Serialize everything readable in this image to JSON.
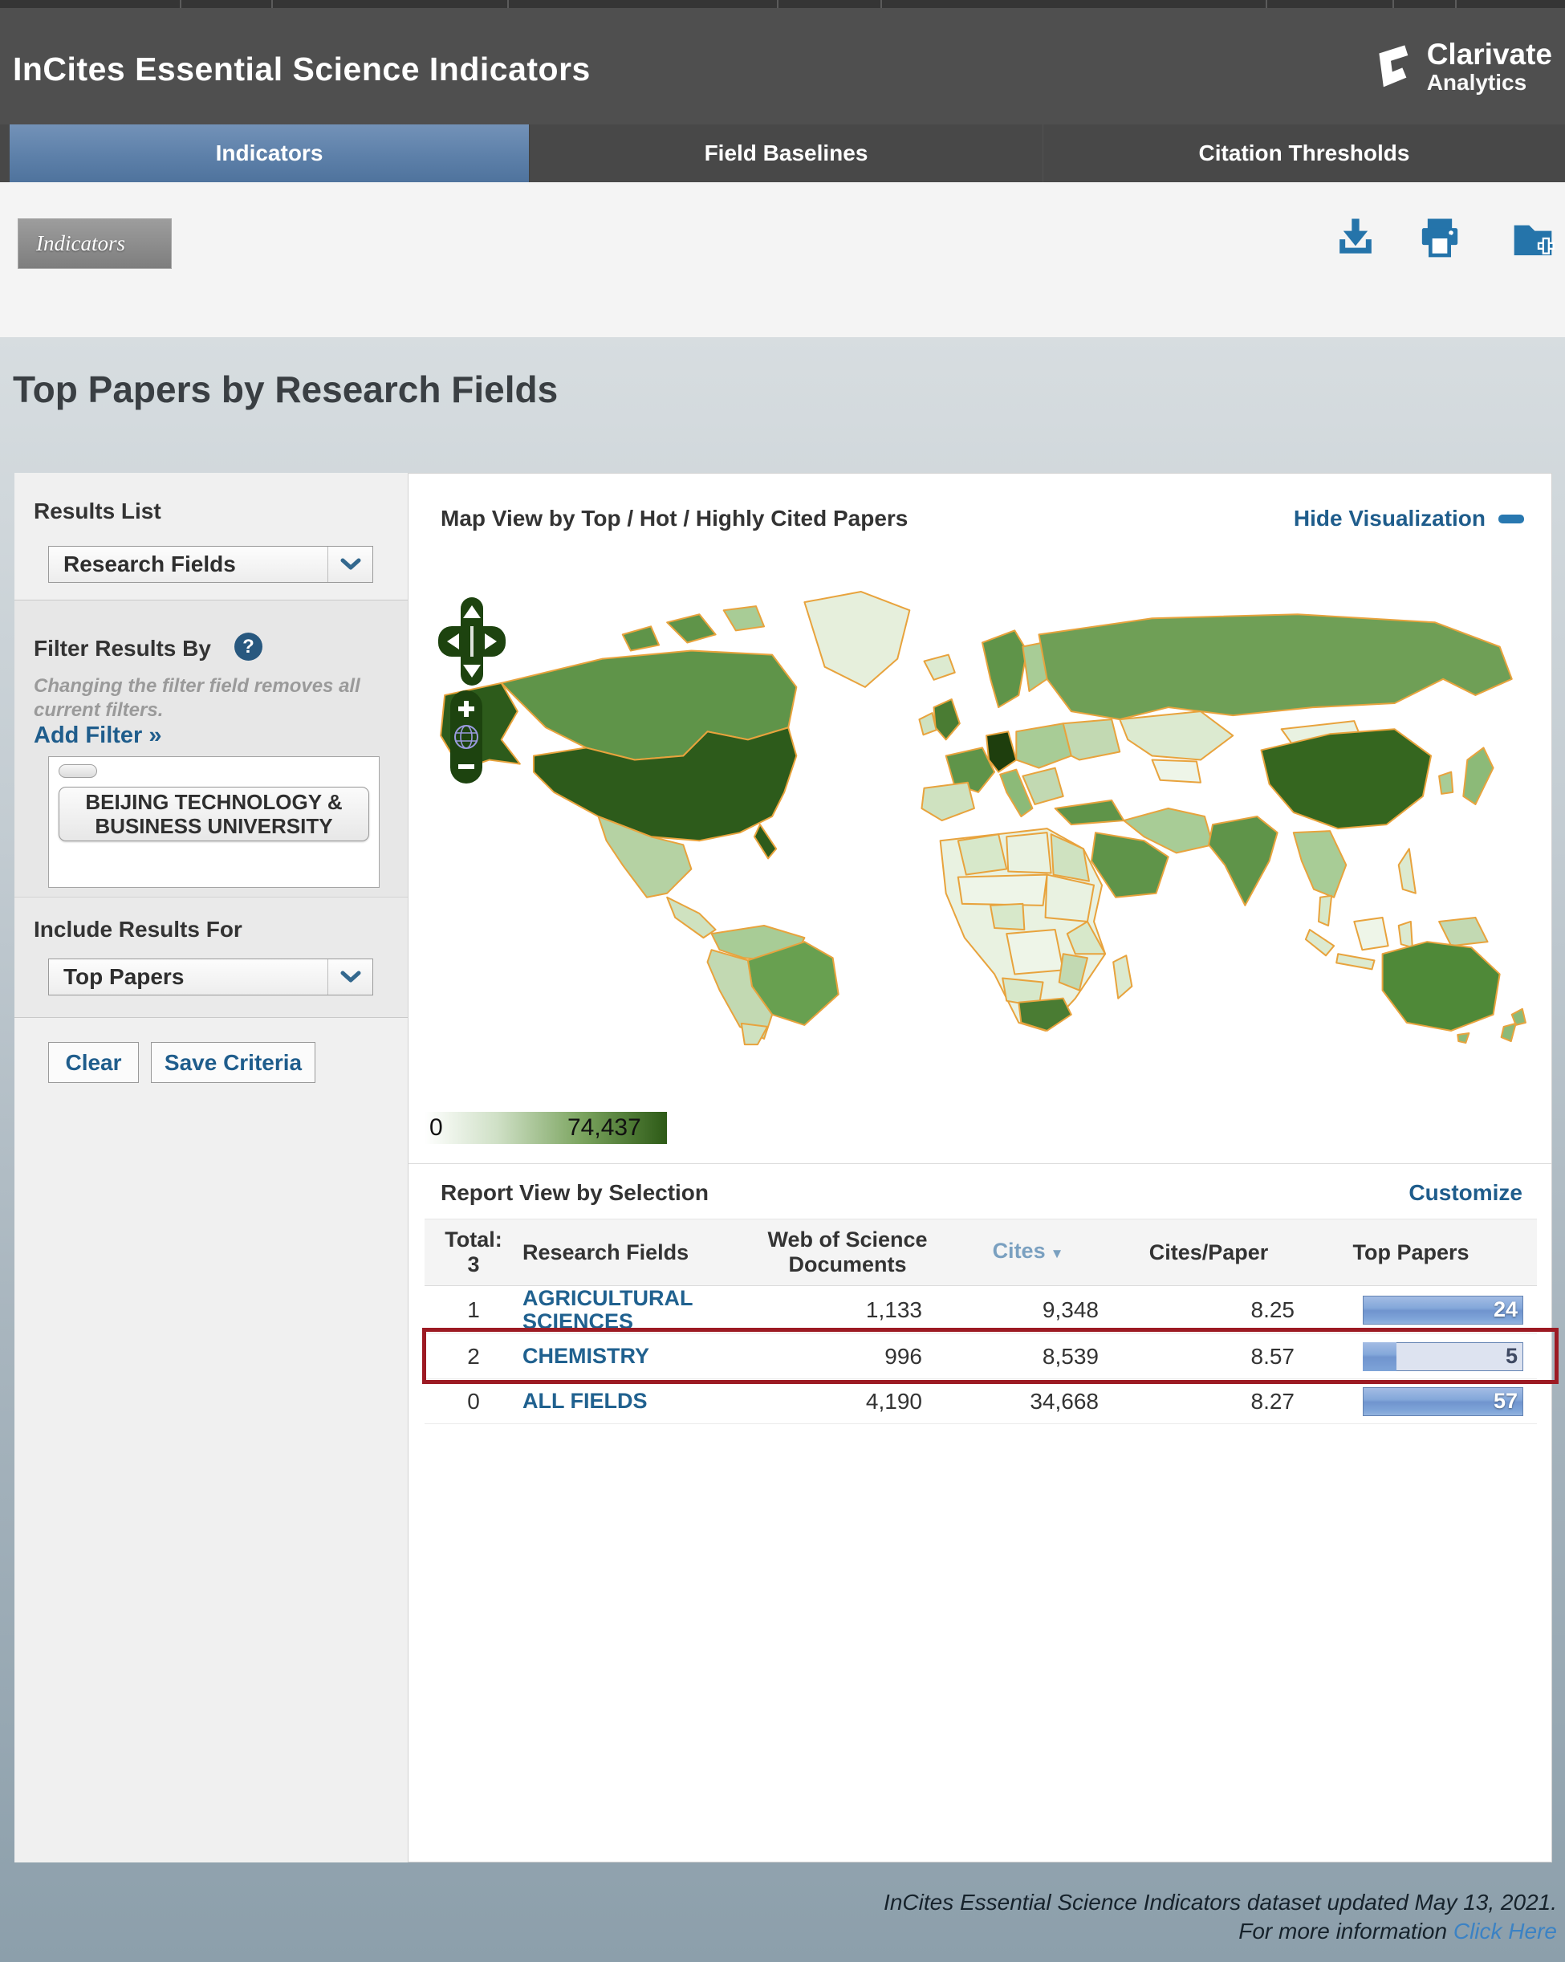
{
  "header": {
    "app_title": "InCites Essential Science Indicators",
    "logo_line1": "Clarivate",
    "logo_line2": "Analytics"
  },
  "tabs": {
    "indicators": "Indicators",
    "field_baselines": "Field Baselines",
    "citation_thresholds": "Citation Thresholds"
  },
  "toolbar": {
    "breadcrumb": "Indicators",
    "icons": [
      "download-icon",
      "print-icon",
      "folder-add-icon"
    ]
  },
  "page": {
    "title": "Top Papers by Research Fields"
  },
  "sidebar": {
    "results_list": {
      "label": "Results List",
      "selected": "Research Fields"
    },
    "filter": {
      "heading": "Filter Results By",
      "help_glyph": "?",
      "note_line1": "Changing the filter field removes all",
      "note_line2": "current filters.",
      "add_filter": "Add Filter »",
      "filter_item": "BEIJING TECHNOLOGY & BUSINESS UNIVERSITY"
    },
    "include": {
      "label": "Include Results For",
      "selected": "Top Papers"
    },
    "buttons": {
      "clear": "Clear",
      "save": "Save Criteria"
    }
  },
  "map_section": {
    "title": "Map View by Top / Hot / Highly Cited Papers",
    "hide_link": "Hide Visualization",
    "legend_min": "0",
    "legend_max": "74,437",
    "legend_colors": {
      "min": "#ffffff",
      "max": "#2d5a16",
      "border": "#e8a33d"
    }
  },
  "report": {
    "title": "Report View by Selection",
    "customize_link": "Customize"
  },
  "table": {
    "total_label": "Total:",
    "total_value": "3",
    "columns": {
      "field": "Research Fields",
      "wos": "Web of Science Documents",
      "cites": "Cites",
      "cites_paper": "Cites/Paper",
      "top_papers": "Top Papers"
    },
    "rows": [
      {
        "rank": "1",
        "field": "AGRICULTURAL SCIENCES",
        "wos": "1,133",
        "cites": "9,348",
        "cites_paper": "8.25",
        "top_papers": "24",
        "bar_pct": 100,
        "highlighted": false
      },
      {
        "rank": "2",
        "field": "CHEMISTRY",
        "wos": "996",
        "cites": "8,539",
        "cites_paper": "8.57",
        "top_papers": "5",
        "bar_pct": 21,
        "highlighted": true
      },
      {
        "rank": "0",
        "field": "ALL FIELDS",
        "wos": "4,190",
        "cites": "34,668",
        "cites_paper": "8.27",
        "top_papers": "57",
        "bar_pct": 100,
        "highlighted": false
      }
    ]
  },
  "footer": {
    "line1": "InCites Essential Science Indicators dataset updated May 13, 2021.",
    "line2_prefix": "For more information ",
    "link": "Click Here"
  }
}
